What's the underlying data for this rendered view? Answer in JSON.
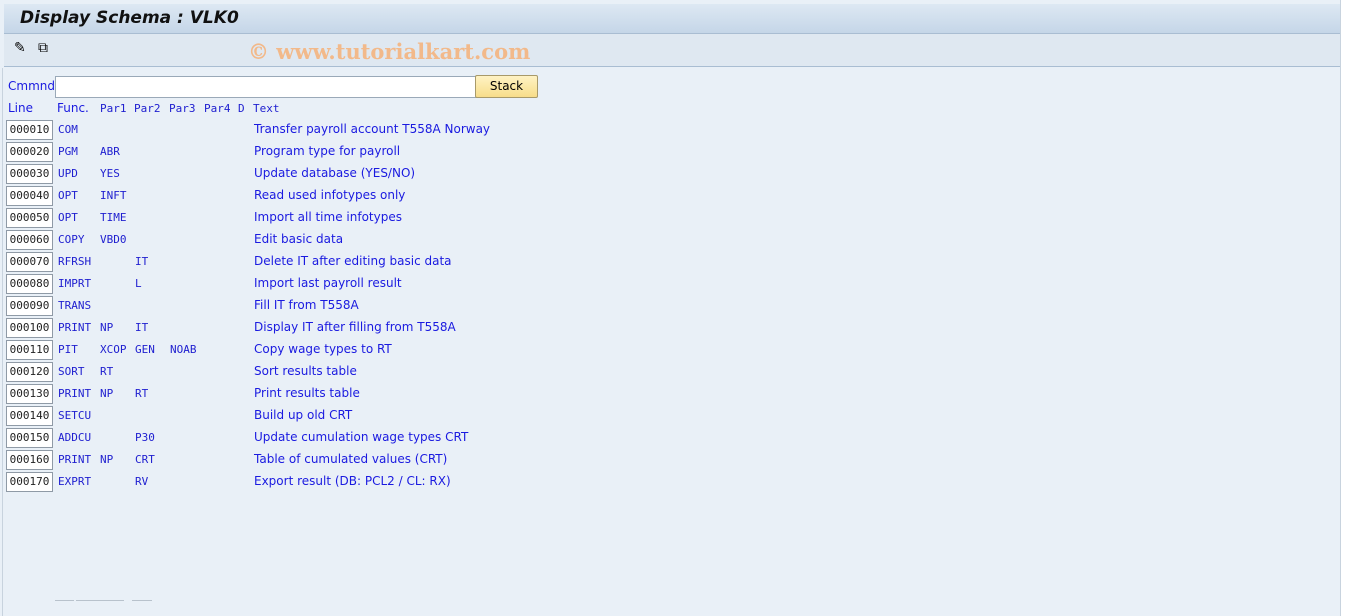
{
  "title": "Display Schema : VLK0",
  "watermark": "© www.tutorialkart.com",
  "toolbar": {
    "icons": [
      "display-change-icon",
      "other-object-icon"
    ]
  },
  "command": {
    "label": "Cmmnd",
    "value": "",
    "stack_label": "Stack"
  },
  "headers": {
    "line": "Line",
    "func": "Func.",
    "par1": "Par1",
    "par2": "Par2",
    "par3": "Par3",
    "par4": "Par4",
    "d": "D",
    "text": "Text"
  },
  "rows": [
    {
      "line": "000010",
      "func": "COM",
      "par1": "",
      "par2": "",
      "par3": "",
      "text": "Transfer payroll account T558A Norway"
    },
    {
      "line": "000020",
      "func": "PGM",
      "par1": "ABR",
      "par2": "",
      "par3": "",
      "text": "Program type for payroll"
    },
    {
      "line": "000030",
      "func": "UPD",
      "par1": "YES",
      "par2": "",
      "par3": "",
      "text": "Update database (YES/NO)"
    },
    {
      "line": "000040",
      "func": "OPT",
      "par1": "INFT",
      "par2": "",
      "par3": "",
      "text": "Read used infotypes only"
    },
    {
      "line": "000050",
      "func": "OPT",
      "par1": "TIME",
      "par2": "",
      "par3": "",
      "text": "Import all time infotypes"
    },
    {
      "line": "000060",
      "func": "COPY",
      "par1": "VBD0",
      "par2": "",
      "par3": "",
      "text": "Edit basic data"
    },
    {
      "line": "000070",
      "func": "RFRSH",
      "par1": "",
      "par2": "IT",
      "par3": "",
      "text": "Delete IT after editing basic data"
    },
    {
      "line": "000080",
      "func": "IMPRT",
      "par1": "",
      "par2": "L",
      "par3": "",
      "text": "Import last payroll result"
    },
    {
      "line": "000090",
      "func": "TRANS",
      "par1": "",
      "par2": "",
      "par3": "",
      "text": "Fill IT from T558A"
    },
    {
      "line": "000100",
      "func": "PRINT",
      "par1": "NP",
      "par2": "IT",
      "par3": "",
      "text": "Display IT after filling from T558A"
    },
    {
      "line": "000110",
      "func": "PIT",
      "par1": "XCOP",
      "par2": "GEN",
      "par3": "NOAB",
      "text": "Copy wage types to RT"
    },
    {
      "line": "000120",
      "func": "SORT",
      "par1": "RT",
      "par2": "",
      "par3": "",
      "text": "Sort results table"
    },
    {
      "line": "000130",
      "func": "PRINT",
      "par1": "NP",
      "par2": "RT",
      "par3": "",
      "text": "Print results table"
    },
    {
      "line": "000140",
      "func": "SETCU",
      "par1": "",
      "par2": "",
      "par3": "",
      "text": "Build up old CRT"
    },
    {
      "line": "000150",
      "func": "ADDCU",
      "par1": "",
      "par2": "P30",
      "par3": "",
      "text": "Update cumulation wage types CRT"
    },
    {
      "line": "000160",
      "func": "PRINT",
      "par1": "NP",
      "par2": "CRT",
      "par3": "",
      "text": "Table of cumulated values (CRT)"
    },
    {
      "line": "000170",
      "func": "EXPRT",
      "par1": "",
      "par2": "RV",
      "par3": "",
      "text": "Export result (DB: PCL2 / CL: RX)"
    }
  ]
}
